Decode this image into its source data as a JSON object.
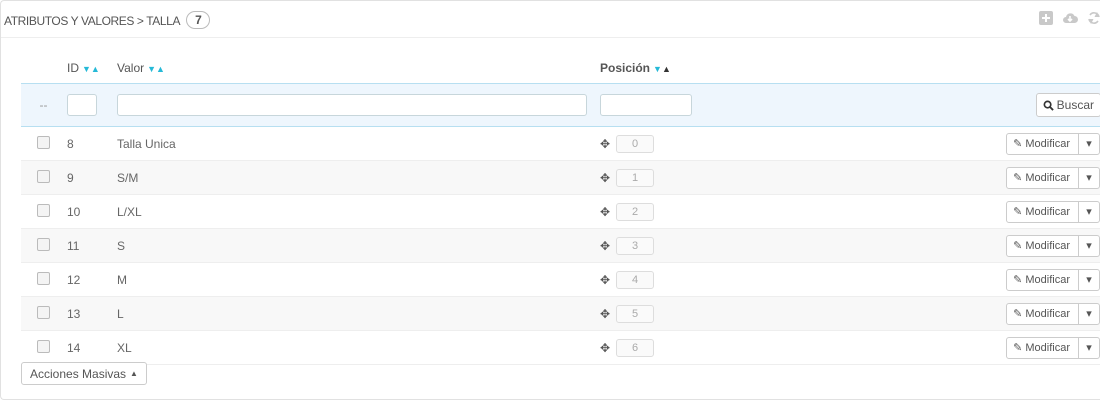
{
  "header": {
    "title": "ATRIBUTOS Y VALORES > TALLA",
    "count": "7",
    "tools": [
      {
        "icon": "add-icon"
      },
      {
        "icon": "cloud-download-icon"
      },
      {
        "icon": "refresh-icon"
      }
    ]
  },
  "columns": {
    "id": "ID",
    "value": "Valor",
    "position": "Posición"
  },
  "filter": {
    "placeholder_dash": "--",
    "id_value": "",
    "value_value": "",
    "position_value": "",
    "search_label": "Buscar"
  },
  "rows": [
    {
      "id": "8",
      "value": "Talla Unica",
      "position": "0"
    },
    {
      "id": "9",
      "value": "S/M",
      "position": "1"
    },
    {
      "id": "10",
      "value": "L/XL",
      "position": "2"
    },
    {
      "id": "11",
      "value": "S",
      "position": "3"
    },
    {
      "id": "12",
      "value": "M",
      "position": "4"
    },
    {
      "id": "13",
      "value": "L",
      "position": "5"
    },
    {
      "id": "14",
      "value": "XL",
      "position": "6"
    }
  ],
  "actions": {
    "edit_label": "Modificar",
    "bulk_label": "Acciones Masivas"
  },
  "colors": {
    "accent": "#25b9d7",
    "filter_bg": "#eef6fd"
  }
}
